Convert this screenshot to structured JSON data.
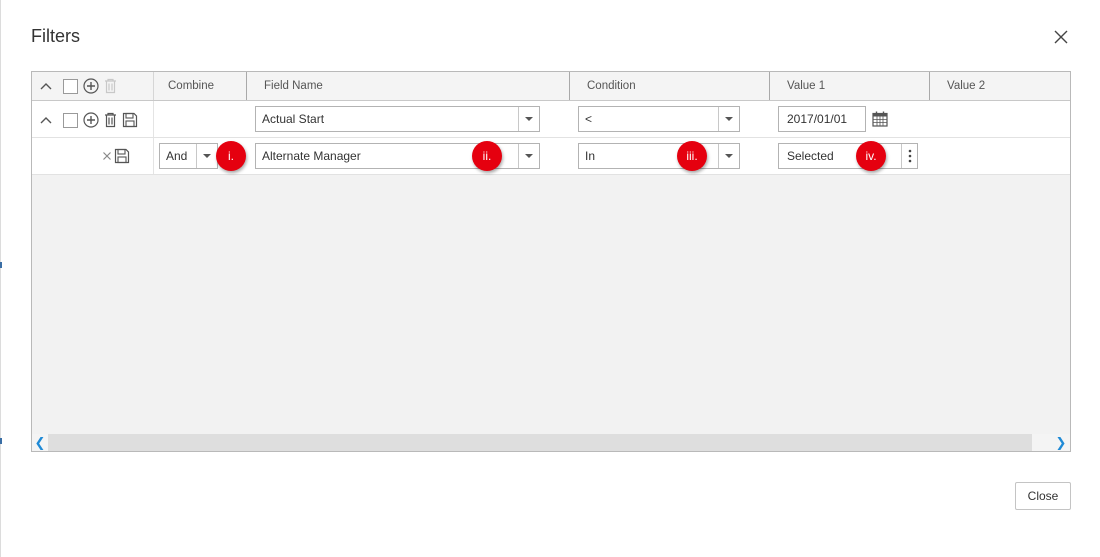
{
  "dialog": {
    "title": "Filters",
    "close_button_label": "Close"
  },
  "grid": {
    "columns": [
      "Combine",
      "Field Name",
      "Condition",
      "Value 1",
      "Value 2"
    ],
    "rows": [
      {
        "combine": "",
        "field_name": "Actual Start",
        "condition": "<",
        "value1": "2017/01/01",
        "value2": ""
      },
      {
        "combine": "And",
        "field_name": "Alternate Manager",
        "condition": "In",
        "value1": "Selected",
        "value2": ""
      }
    ]
  },
  "callouts": [
    "i.",
    "ii.",
    "iii.",
    "iv."
  ],
  "icons": {
    "header": [
      "collapse-chevron-icon",
      "select-all-checkbox",
      "add-icon",
      "delete-icon"
    ],
    "row1": [
      "collapse-chevron-icon",
      "row-checkbox",
      "add-icon",
      "delete-icon",
      "save-icon",
      "calendar-icon"
    ],
    "row2": [
      "remove-x-icon",
      "save-icon",
      "more-options-icon"
    ]
  },
  "colors": {
    "callout_badge": "#e5000f",
    "scroll_arrow": "#1f8ad6",
    "grid_background": "#f2f2f2"
  }
}
